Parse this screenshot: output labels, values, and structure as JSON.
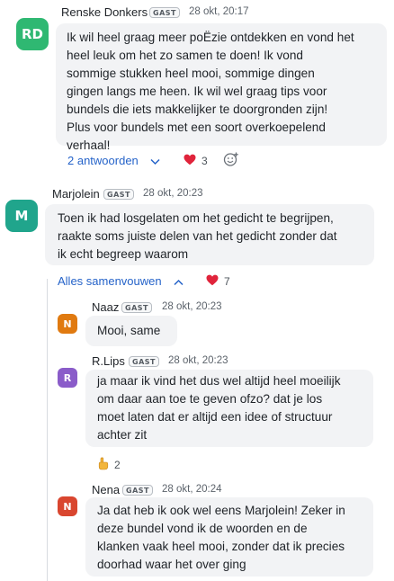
{
  "messages": [
    {
      "author": "Renske Donkers",
      "badge": "GAST",
      "time": "28 okt, 20:17",
      "avatar": "RD",
      "avatar_color": "#2fb872",
      "lines": [
        "Ik wil heel graag meer poËzie ontdekken en vond het",
        "heel leuk om het zo samen te doen! Ik vond",
        "sommige stukken heel mooi, sommige dingen",
        "gingen langs me heen. Ik wil wel graag tips voor",
        "bundels die iets makkelijker te doorgronden zijn!",
        "Plus voor bundels met een soort overkoepelend",
        "verhaal!"
      ],
      "replies_label": "2 antwoorden",
      "reaction_icon": "heart-icon",
      "reaction_count": "3"
    },
    {
      "author": "Marjolein",
      "badge": "GAST",
      "time": "28 okt, 20:23",
      "avatar": "M",
      "avatar_color": "#20a58c",
      "lines": [
        "Toen ik had losgelaten om het gedicht te begrijpen,",
        "raakte soms juiste delen van het gedicht zonder dat",
        "ik echt begreep waarom"
      ],
      "collapse_label": "Alles samenvouwen",
      "reaction_icon": "heart-icon",
      "reaction_count": "7",
      "replies": [
        {
          "author": "Naaz",
          "badge": "GAST",
          "time": "28 okt, 20:23",
          "avatar": "N",
          "avatar_color": "#e07a10",
          "lines": [
            "Mooi, same"
          ]
        },
        {
          "author": "R.Lips",
          "badge": "GAST",
          "time": "28 okt, 20:23",
          "avatar": "R",
          "avatar_color": "#8a5cc9",
          "lines": [
            "ja maar ik vind het dus wel altijd heel moeilijk",
            "om daar aan toe te geven ofzo? dat je los",
            "moet laten dat er altijd een idee of structuur",
            "achter zit"
          ],
          "reaction_icon": "pointing-up-hand-icon",
          "reaction_count": "2"
        },
        {
          "author": "Nena",
          "badge": "GAST",
          "time": "28 okt, 20:24",
          "avatar": "N",
          "avatar_color": "#d9462f",
          "lines": [
            "Ja dat heb ik ook wel eens Marjolein! Zeker in",
            "deze bundel vond ik de woorden en de",
            "klanken vaak heel mooi, zonder dat ik precies",
            "doorhad waar het over ging"
          ]
        }
      ]
    }
  ]
}
